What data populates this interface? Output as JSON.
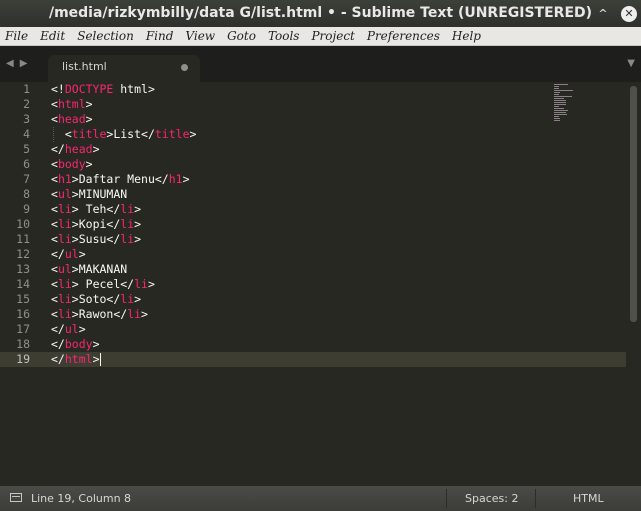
{
  "window": {
    "title": "/media/rizkymbilly/data G/list.html • - Sublime Text (UNREGISTERED)",
    "minimize_glyph": "⌄",
    "restore_glyph": "^",
    "close_glyph": "✕"
  },
  "menu": [
    "File",
    "Edit",
    "Selection",
    "Find",
    "View",
    "Goto",
    "Tools",
    "Project",
    "Preferences",
    "Help"
  ],
  "tabbar": {
    "nav_glyph": "◀▶",
    "dropdown_glyph": "▼",
    "tab": {
      "label": "list.html",
      "modified": true
    }
  },
  "editor": {
    "active_line": 19,
    "lines": [
      {
        "num": "1",
        "text": "<!DOCTYPE html>"
      },
      {
        "num": "2",
        "text": "<html>"
      },
      {
        "num": "3",
        "text": "<head>"
      },
      {
        "num": "4",
        "text": "  <title>List</title>"
      },
      {
        "num": "5",
        "text": "</head>"
      },
      {
        "num": "6",
        "text": "<body>"
      },
      {
        "num": "7",
        "text": "<h1>Daftar Menu</h1>"
      },
      {
        "num": "8",
        "text": "<ul>MINUMAN"
      },
      {
        "num": "9",
        "text": "<li> Teh</li>"
      },
      {
        "num": "10",
        "text": "<li>Kopi</li>"
      },
      {
        "num": "11",
        "text": "<li>Susu</li>"
      },
      {
        "num": "12",
        "text": "</ul>"
      },
      {
        "num": "13",
        "text": "<ul>MAKANAN"
      },
      {
        "num": "14",
        "text": "<li> Pecel</li>"
      },
      {
        "num": "15",
        "text": "<li>Soto</li>"
      },
      {
        "num": "16",
        "text": "<li>Rawon</li>"
      },
      {
        "num": "17",
        "text": "</ul>"
      },
      {
        "num": "18",
        "text": "</body>"
      },
      {
        "num": "19",
        "text": "</html>"
      }
    ]
  },
  "status": {
    "position": "Line 19, Column 8",
    "spaces": "Spaces: 2",
    "syntax": "HTML"
  },
  "colors": {
    "background": "#272822",
    "tag": "#f92672",
    "text": "#f8f8f2",
    "line_number": "#8f908a",
    "active_line": "#3e3d32"
  }
}
